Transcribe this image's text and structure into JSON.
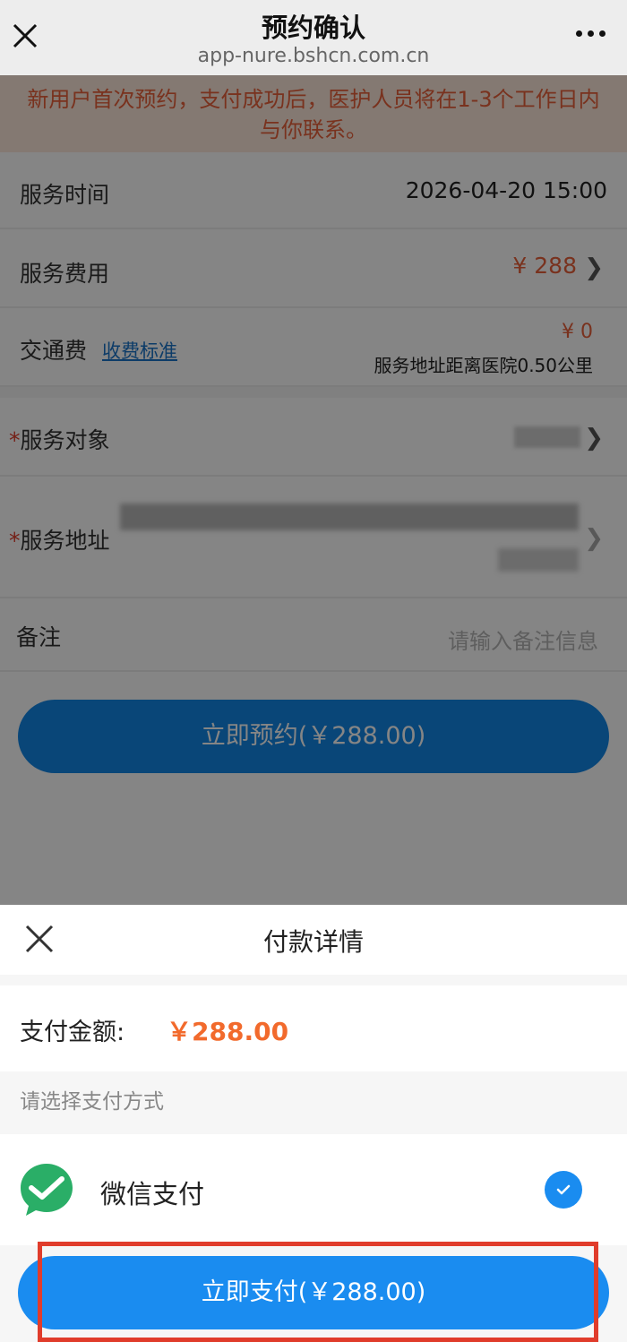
{
  "nav": {
    "title": "预约确认",
    "url": "app-nure.bshcn.com.cn"
  },
  "notice": "新用户首次预约，支付成功后，医护人员将在1-3个工作日内与你联系。",
  "form": {
    "service_time_label": "服务时间",
    "service_time_value": "2026-04-20 15:00",
    "service_fee_label": "服务费用",
    "service_fee_value": "¥ 288",
    "transport_label": "交通费",
    "transport_link": "收费标准",
    "transport_value": "¥ 0",
    "distance": "服务地址距离医院0.50公里",
    "target_label": "服务对象",
    "address_label": "服务地址",
    "required_mark": "*",
    "remark_label": "备注",
    "remark_placeholder": "请输入备注信息"
  },
  "reserve_button": "立即预约(￥288.00)",
  "sheet": {
    "title": "付款详情",
    "amount_label": "支付金额:",
    "amount_value": "￥288.00",
    "choose_label": "请选择支付方式",
    "method_name": "微信支付",
    "pay_button": "立即支付(￥288.00)"
  },
  "colors": {
    "accent": "#1a8cf0",
    "price": "#f26a2c",
    "highlight": "#e03c2b",
    "wechat": "#2aae67"
  }
}
